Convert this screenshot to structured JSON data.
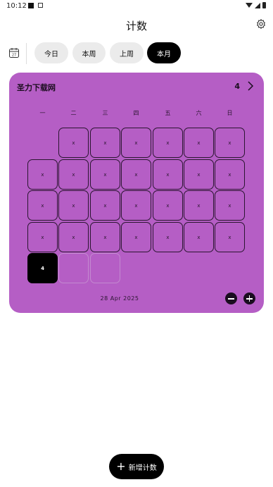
{
  "status_bar": {
    "time": "10:12"
  },
  "header": {
    "title": "计数"
  },
  "tabs": [
    {
      "label": "今日",
      "active": false
    },
    {
      "label": "本周",
      "active": false
    },
    {
      "label": "上周",
      "active": false
    },
    {
      "label": "本月",
      "active": true
    }
  ],
  "card": {
    "name": "圣力下载网",
    "count": "4",
    "color": "#b55ec5",
    "weekdays": [
      "一",
      "二",
      "三",
      "四",
      "五",
      "六",
      "日"
    ],
    "calendar_rows": [
      [
        "",
        "x",
        "x",
        "x",
        "x",
        "x",
        "x"
      ],
      [
        "x",
        "x",
        "x",
        "x",
        "x",
        "x",
        "x"
      ],
      [
        "x",
        "x",
        "x",
        "x",
        "x",
        "x",
        "x"
      ],
      [
        "x",
        "x",
        "x",
        "x",
        "x",
        "x",
        "x"
      ],
      [
        "4",
        "",
        ""
      ]
    ],
    "date_label": "28  Apr  2025"
  },
  "fab": {
    "label": "新增计数"
  }
}
